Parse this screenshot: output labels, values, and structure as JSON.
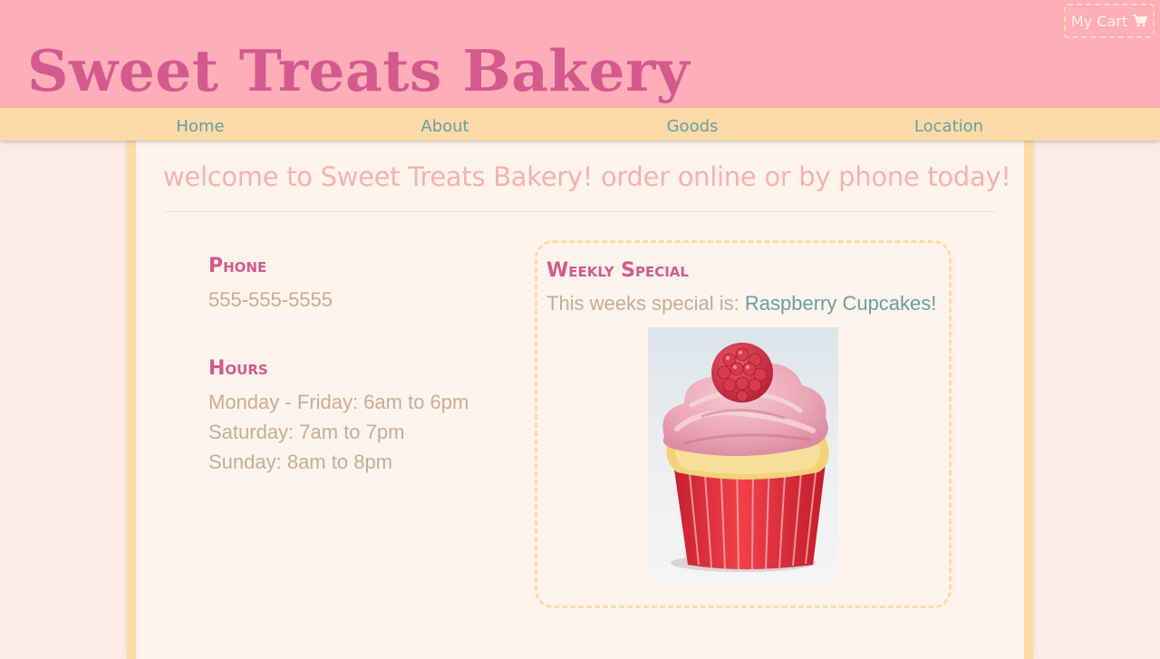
{
  "header": {
    "title": "Sweet Treats Bakery",
    "cart_label": "My Cart",
    "cart_icon": "shopping-cart-icon"
  },
  "nav": {
    "items": [
      {
        "label": "Home"
      },
      {
        "label": "About"
      },
      {
        "label": "Goods"
      },
      {
        "label": "Location"
      }
    ]
  },
  "main": {
    "welcome": "welcome to Sweet Treats Bakery! order online or by phone today!",
    "phone": {
      "heading": "Phone",
      "number": "555-555-5555"
    },
    "hours": {
      "heading": "Hours",
      "lines": [
        "Monday - Friday: 6am to 6pm",
        "Saturday: 7am to 7pm",
        "Sunday: 8am to 8pm"
      ]
    },
    "special": {
      "heading": "Weekly Special",
      "prefix": "This weeks special is: ",
      "item": "Raspberry Cupcakes!",
      "image": "raspberry-cupcake-photo"
    }
  },
  "colors": {
    "header_bg": "#ffadb8",
    "title": "#d45a8e",
    "nav_bg": "#fddba8",
    "nav_text": "#6b9da4",
    "page_bg": "#fdebe8",
    "panel_bg": "#fff4eb",
    "welcome_text": "#f6b2b0",
    "body_text": "#c9ab95"
  }
}
